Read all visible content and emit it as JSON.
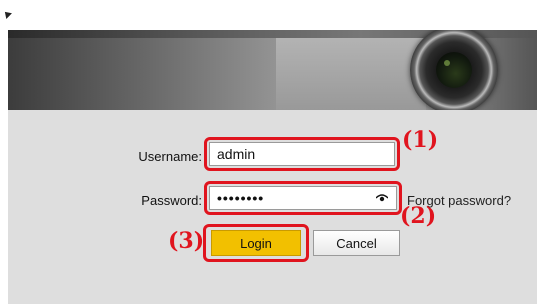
{
  "login": {
    "username_label": "Username:",
    "username_value": "admin",
    "password_label": "Password:",
    "password_value": "••••••••",
    "forgot_password": "Forgot password?",
    "login_button": "Login",
    "cancel_button": "Cancel"
  },
  "annotations": {
    "step1": "1",
    "step2": "2",
    "step3": "3"
  },
  "icons": {
    "password_toggle": "eye-icon",
    "corner_mark": "arrow-icon"
  },
  "colors": {
    "highlight": "#e0141e",
    "login_button": "#f2c000",
    "panel_background": "#dedede"
  }
}
